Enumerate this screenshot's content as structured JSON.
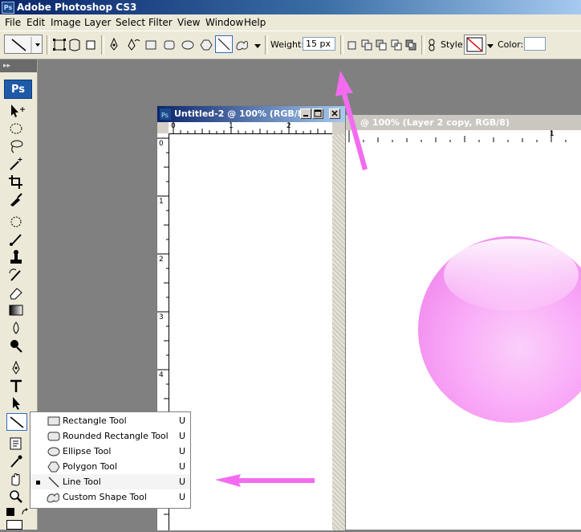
{
  "app": {
    "title": "Adobe Photoshop CS3",
    "logo": "Ps"
  },
  "menu": [
    "File",
    "Edit",
    "Image",
    "Layer",
    "Select",
    "Filter",
    "View",
    "Window",
    "Help"
  ],
  "options": {
    "weight_label": "Weight:",
    "weight_value": "15 px",
    "style_label": "Style:",
    "color_label": "Color:"
  },
  "tools": {
    "logo": "Ps",
    "grip": "▸▸"
  },
  "doc1": {
    "title": "Untitled-2 @ 100% (RGB/8)",
    "hruler": [
      "0",
      "1",
      "2"
    ],
    "vruler": [
      "0",
      "1",
      "2",
      "3",
      "4"
    ]
  },
  "doc2": {
    "title": "@ 100% (Layer 2 copy, RGB/8)",
    "hruler": [
      "1"
    ],
    "artwork_color": "#f9a3f6"
  },
  "flyout": {
    "items": [
      {
        "label": "Rectangle Tool",
        "shortcut": "U",
        "icon": "rectangle-icon",
        "selected": false
      },
      {
        "label": "Rounded Rectangle Tool",
        "shortcut": "U",
        "icon": "rounded-rectangle-icon",
        "selected": false
      },
      {
        "label": "Ellipse Tool",
        "shortcut": "U",
        "icon": "ellipse-icon",
        "selected": false
      },
      {
        "label": "Polygon Tool",
        "shortcut": "U",
        "icon": "polygon-icon",
        "selected": false
      },
      {
        "label": "Line Tool",
        "shortcut": "U",
        "icon": "line-icon",
        "selected": true
      },
      {
        "label": "Custom Shape Tool",
        "shortcut": "U",
        "icon": "custom-shape-icon",
        "selected": false
      }
    ]
  },
  "annotation_color": "#f36cf0"
}
